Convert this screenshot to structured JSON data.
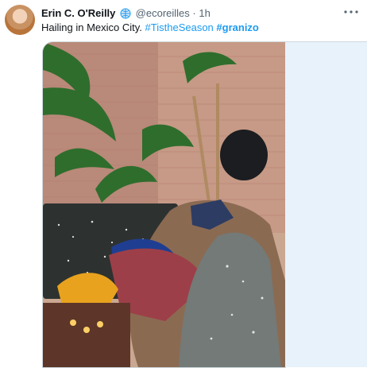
{
  "tweet": {
    "author_name": "Erin C. O'Reilly",
    "handle": "@ecoreilles",
    "separator": "·",
    "time": "1h",
    "text_prefix": "Hailing in Mexico City.",
    "hashtags": [
      "#TistheSeason",
      "#granizo"
    ],
    "icons": {
      "verified": "globe-icon",
      "more": "more-icon"
    },
    "media_alt": "Patio with potted plants, cushions and hail"
  }
}
